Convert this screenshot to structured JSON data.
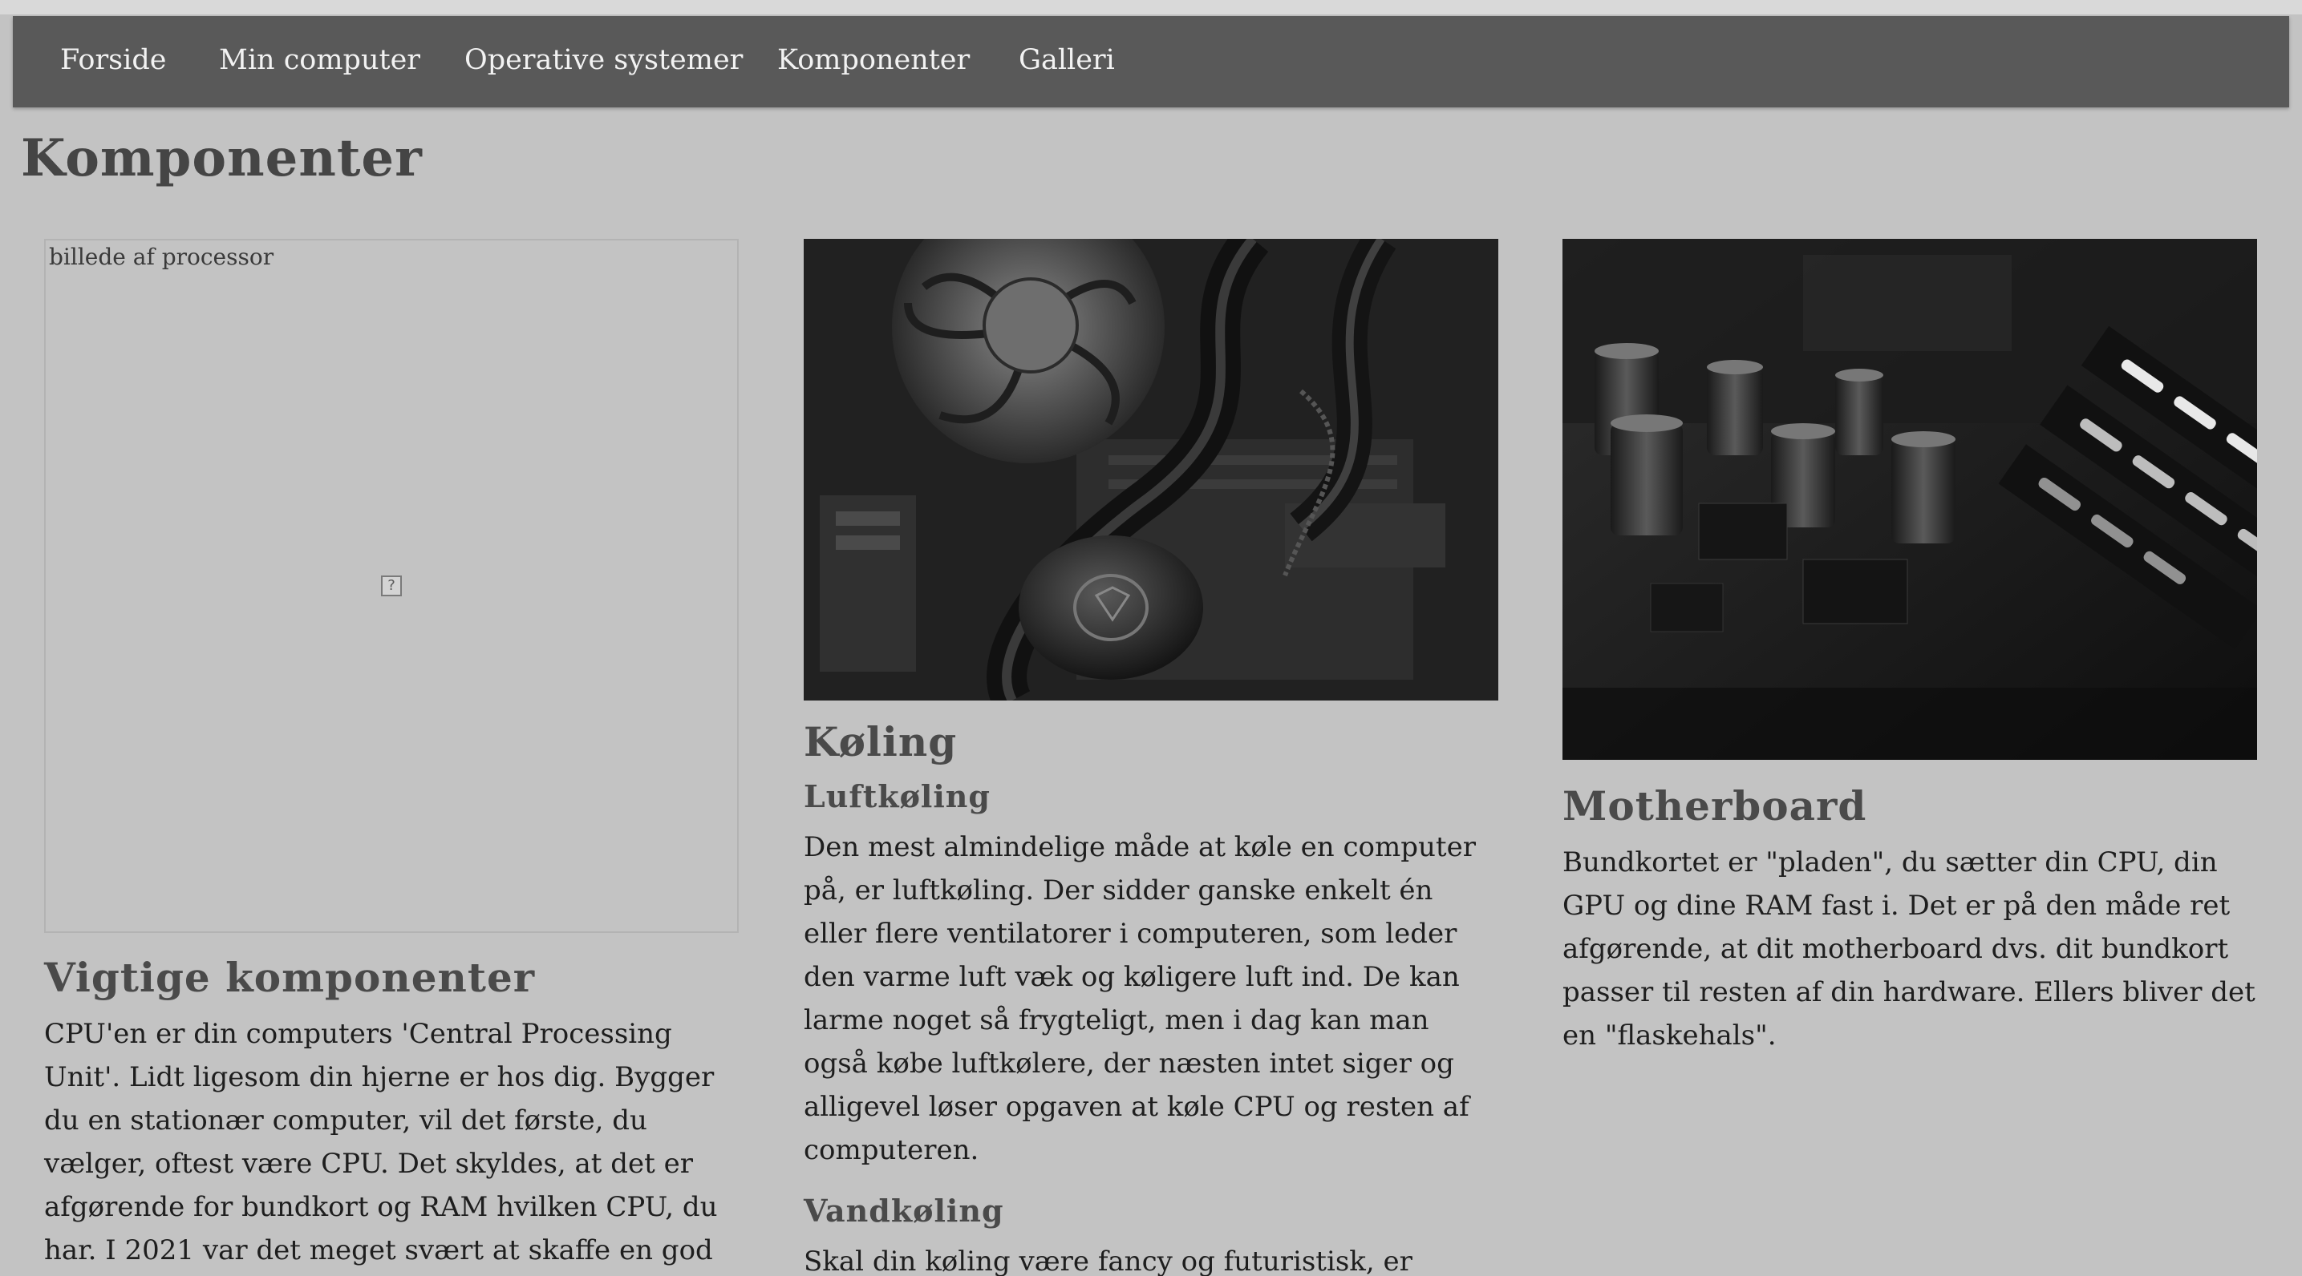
{
  "nav": {
    "items": [
      {
        "label": "Forside"
      },
      {
        "label": "Min computer"
      },
      {
        "label": "Operative systemer"
      },
      {
        "label": "Komponenter"
      },
      {
        "label": "Galleri"
      }
    ]
  },
  "page": {
    "title": "Komponenter"
  },
  "columns": {
    "cpu": {
      "image_alt": "billede af processor",
      "heading": "Vigtige komponenter",
      "text": "CPU'en er din computers 'Central Processing Unit'. Lidt ligesom din hjerne er hos dig. Bygger du en stationær computer, vil det første, du vælger, oftest være CPU. Det skyldes, at det er afgørende for bundkort og RAM hvilken CPU, du har. I 2021 var det meget svært at skaffe en god CPU, da producenterne"
    },
    "cooling": {
      "heading": "Køling",
      "sub1": "Luftkøling",
      "text1": "Den mest almindelige måde at køle en computer på, er luftkøling. Der sidder ganske enkelt én eller flere ventilatorer i computeren, som leder den varme luft væk og køligere luft ind. De kan larme noget så frygteligt, men i dag kan man også købe luftkølere, der næsten intet siger og alligevel løser opgaven at køle CPU og resten af computeren.",
      "sub2": "Vandkøling",
      "text2": "Skal din køling være fancy og futuristisk, er"
    },
    "motherboard": {
      "heading": "Motherboard",
      "text": "Bundkortet er \"pladen\", du sætter din CPU, din GPU og dine RAM fast i. Det er på den måde ret afgørende, at dit motherboard dvs. dit bundkort passer til resten af din hardware. Ellers bliver det en \"flaskehals\"."
    }
  }
}
